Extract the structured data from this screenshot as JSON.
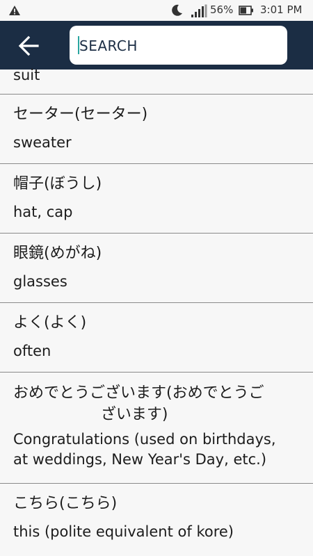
{
  "status_bar": {
    "battery": "56%",
    "time": "3:01 PM"
  },
  "search": {
    "placeholder": "SEARCH",
    "value": ""
  },
  "entries": [
    {
      "japanese": "",
      "english": "suit"
    },
    {
      "japanese": "セーター(セーター)",
      "english": "sweater"
    },
    {
      "japanese": "帽子(ぼうし)",
      "english": "hat, cap"
    },
    {
      "japanese": "眼鏡(めがね)",
      "english": "glasses"
    },
    {
      "japanese": "よく(よく)",
      "english": "often"
    },
    {
      "japanese": "おめでとうございます(おめでとうご\n                  ざいます)",
      "english": "Congratulations (used on birthdays,\nat weddings, New Year's Day, etc.)"
    },
    {
      "japanese": "こちら(こちら)",
      "english": "this (polite equivalent of kore)"
    }
  ],
  "colors": {
    "app_bar": "#1b2d44",
    "background": "#f7f7f7",
    "divider": "#8a8a8a",
    "caret": "#2aa6a0"
  },
  "icons": {
    "status_left": "warning-triangle-icon",
    "dnd": "moon-icon",
    "signal": "cell-signal-icon",
    "battery": "battery-icon",
    "back": "arrow-left-icon"
  }
}
